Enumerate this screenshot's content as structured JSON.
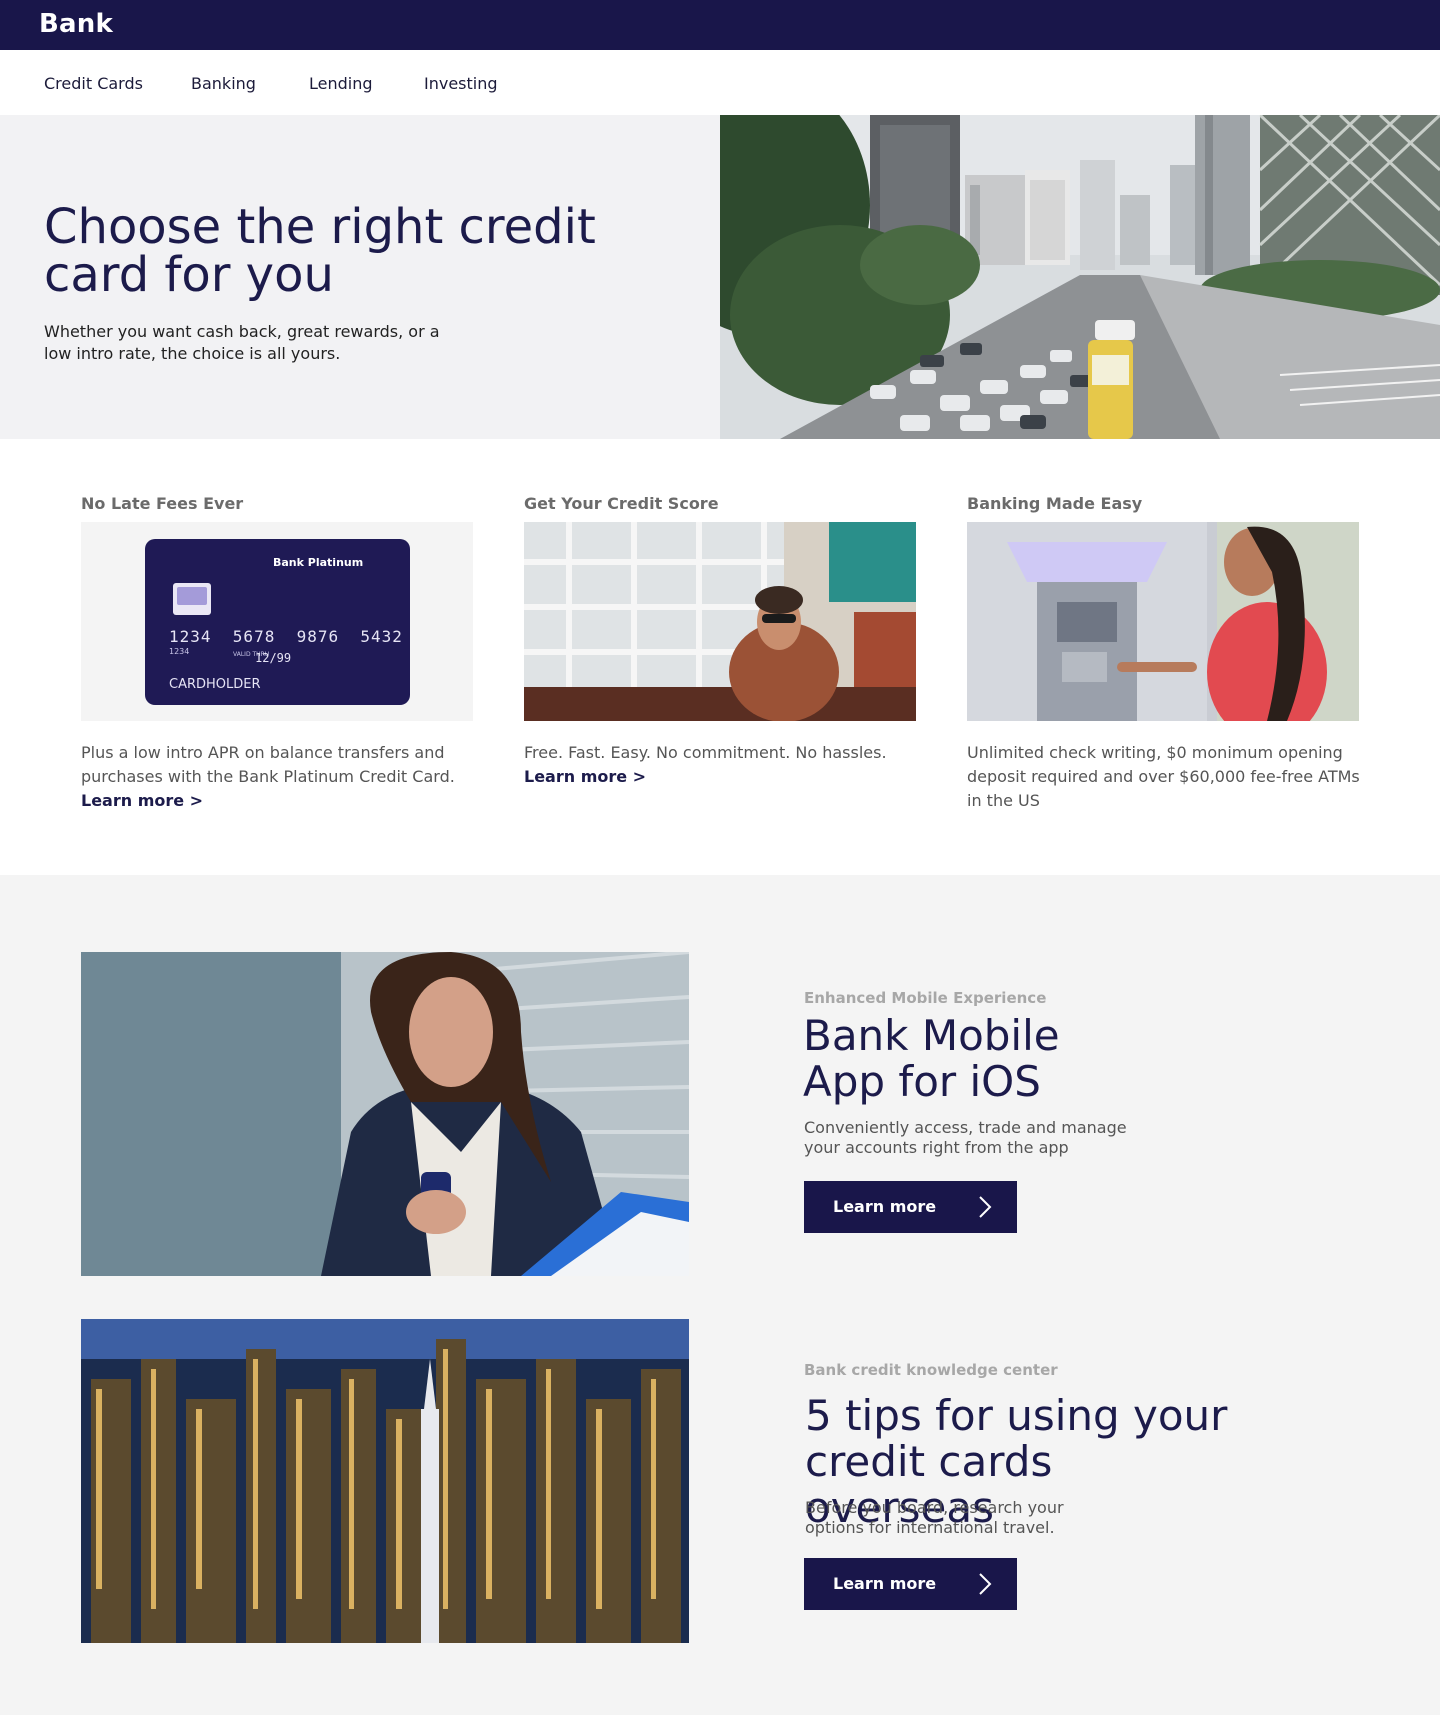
{
  "header": {
    "brand": "Bank"
  },
  "nav": {
    "items": [
      {
        "label": "Credit Cards"
      },
      {
        "label": "Banking"
      },
      {
        "label": "Lending"
      },
      {
        "label": "Investing"
      }
    ]
  },
  "hero": {
    "title": "Choose the right credit card for you",
    "subtitle": "Whether you want cash back, great rewards, or a low intro rate, the choice is all yours."
  },
  "cards": [
    {
      "title": "No Late Fees Ever",
      "text": "Plus a low intro APR on balance transfers and purchases with the Bank Platinum Credit Card.",
      "link": "Learn more >",
      "credit_card": {
        "name": "Bank Platinum",
        "number": "1234  5678  9876  5432",
        "small_number": "1234",
        "valid_label": "VALID THRU",
        "expiry": "12/99",
        "holder": "CARDHOLDER"
      }
    },
    {
      "title": "Get Your Credit Score",
      "text": "Free. Fast. Easy. No commitment. No hassles.",
      "link": "Learn more >"
    },
    {
      "title": "Banking Made Easy",
      "text": "Unlimited check writing, $0 monimum opening deposit required and over $60,000 fee-free ATMs in the US"
    }
  ],
  "features": [
    {
      "eyebrow": "Enhanced Mobile Experience",
      "title": "Bank Mobile App for iOS",
      "subtitle": "Conveniently access, trade and manage your accounts right from the app",
      "button": "Learn more"
    },
    {
      "eyebrow": "Bank credit knowledge center",
      "title": "5 tips for using your credit cards overseas",
      "subtitle": "Before you board, research your options for international travel.",
      "button": "Learn more"
    }
  ],
  "icons": {
    "button_arrow": "chevron-right-icon"
  },
  "colors": {
    "brand": "#19164a",
    "text_dark": "#1c1b4b",
    "muted": "#6b6b6b"
  }
}
